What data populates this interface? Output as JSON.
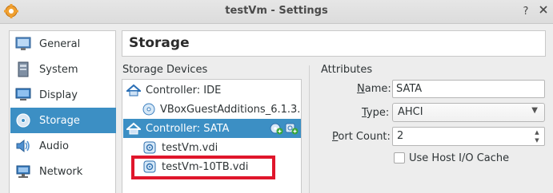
{
  "window": {
    "title": "testVm - Settings"
  },
  "nav": {
    "items": [
      {
        "label": "General",
        "icon": "general-icon"
      },
      {
        "label": "System",
        "icon": "system-icon"
      },
      {
        "label": "Display",
        "icon": "display-icon"
      },
      {
        "label": "Storage",
        "icon": "storage-icon",
        "active": true
      },
      {
        "label": "Audio",
        "icon": "audio-icon"
      },
      {
        "label": "Network",
        "icon": "network-icon"
      }
    ]
  },
  "page": {
    "title": "Storage"
  },
  "storage_devices": {
    "label": "Storage Devices",
    "tree": [
      {
        "label": "Controller: IDE",
        "type": "controller"
      },
      {
        "label": "VBoxGuestAdditions_6.1.3...",
        "type": "optical"
      },
      {
        "label": "Controller: SATA",
        "type": "controller",
        "selected": true
      },
      {
        "label": "testVm.vdi",
        "type": "disk"
      },
      {
        "label": "testVm-10TB.vdi",
        "type": "disk",
        "highlighted": true
      }
    ]
  },
  "attributes": {
    "label": "Attributes",
    "name_label_pre": "",
    "name_label_ul": "N",
    "name_label_post": "ame:",
    "name_value": "SATA",
    "type_label_ul": "T",
    "type_label_post": "ype:",
    "type_value": "AHCI",
    "port_label_ul": "P",
    "port_label_post": "ort Count:",
    "port_value": "2",
    "cache_label": "Use Host I/O Cache",
    "cache_checked": false
  },
  "colors": {
    "selection": "#3c8fc4",
    "highlight_box": "#e0162b"
  }
}
